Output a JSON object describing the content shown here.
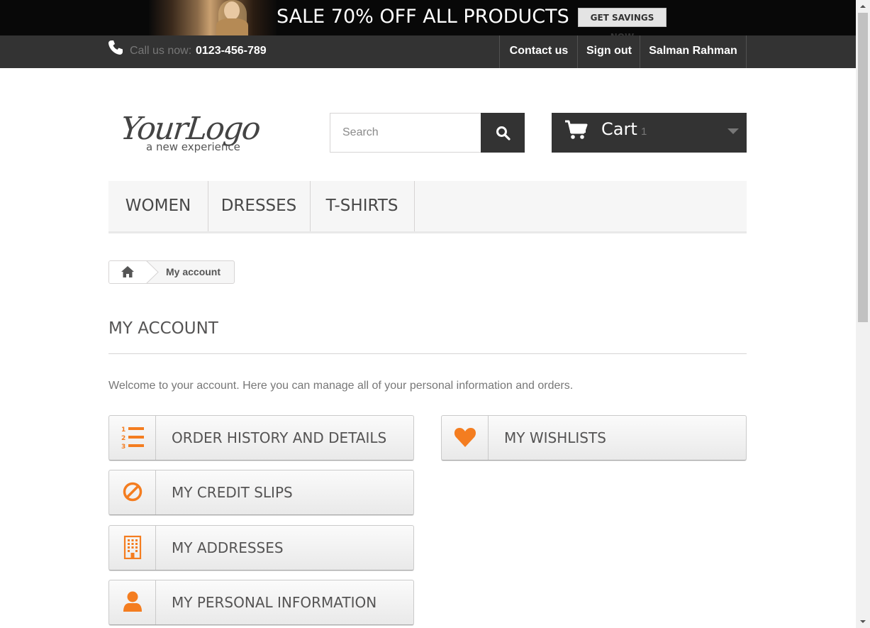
{
  "banner": {
    "headline": "SALE 70% OFF ALL PRODUCTS",
    "button_label": "GET SAVINGS NOW"
  },
  "topbar": {
    "call_label": "Call us now:",
    "phone_number": "0123-456-789",
    "links": [
      {
        "label": "Contact us"
      },
      {
        "label": "Sign out"
      },
      {
        "label": "Salman Rahman"
      }
    ]
  },
  "header": {
    "logo_text": "YourLogo",
    "logo_tagline": "a new experience",
    "search_placeholder": "Search",
    "cart_label": "Cart",
    "cart_count": "1"
  },
  "menu": {
    "items": [
      {
        "label": "WOMEN"
      },
      {
        "label": "DRESSES"
      },
      {
        "label": "T-SHIRTS"
      }
    ]
  },
  "breadcrumb": {
    "current": "My account"
  },
  "main": {
    "title": "MY ACCOUNT",
    "welcome": "Welcome to your account. Here you can manage all of your personal information and orders.",
    "buttons": [
      {
        "label": "ORDER HISTORY AND DETAILS",
        "icon": "list-ol-icon"
      },
      {
        "label": "MY CREDIT SLIPS",
        "icon": "ban-icon"
      },
      {
        "label": "MY ADDRESSES",
        "icon": "building-icon"
      },
      {
        "label": "MY PERSONAL INFORMATION",
        "icon": "user-icon"
      },
      {
        "label": "MY WISHLISTS",
        "icon": "heart-icon"
      }
    ]
  },
  "colors": {
    "accent": "#f47d20",
    "dark": "#333333",
    "banner": "#080808"
  }
}
